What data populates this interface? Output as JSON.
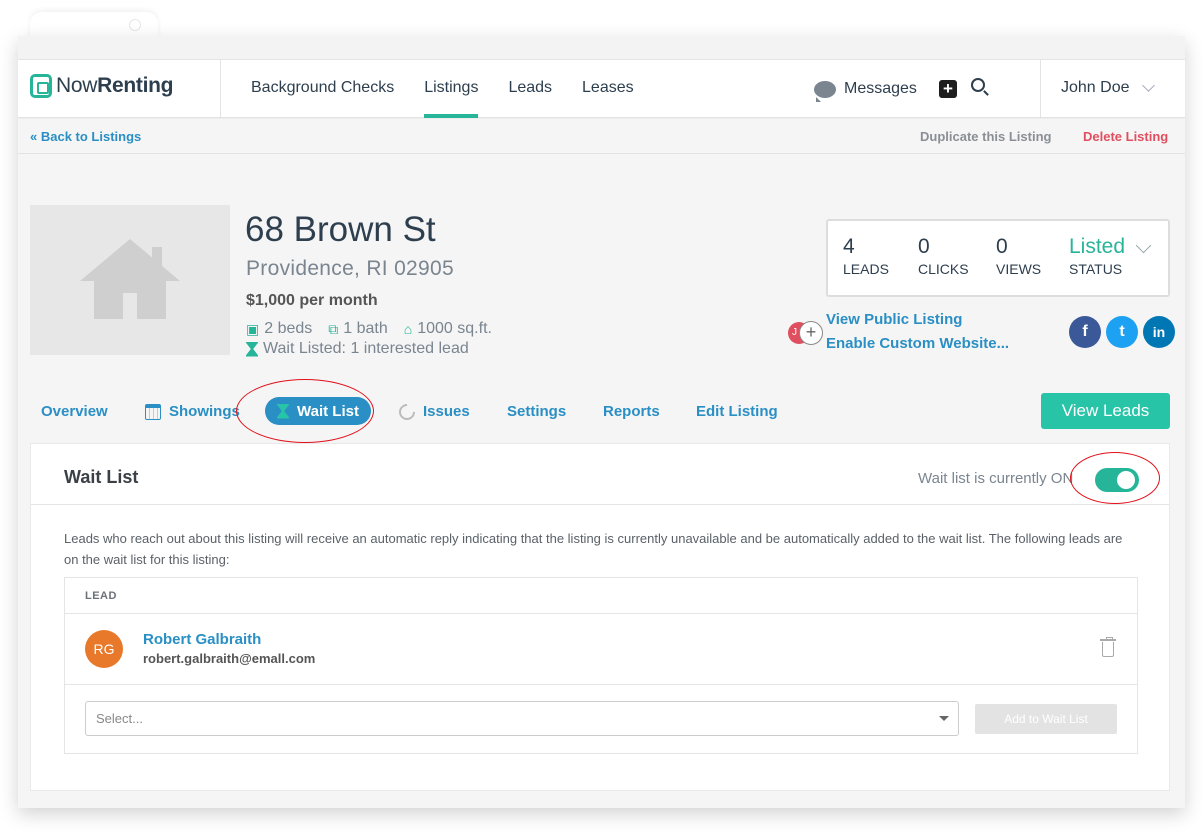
{
  "brand": {
    "name_part1": "Now",
    "name_part2": "Renting"
  },
  "nav": {
    "links": [
      "Background Checks",
      "Listings",
      "Leads",
      "Leases"
    ],
    "active": "Listings",
    "messages_label": "Messages",
    "user_name": "John Doe"
  },
  "subbar": {
    "back": "« Back to Listings",
    "duplicate": "Duplicate this Listing",
    "delete": "Delete Listing"
  },
  "listing": {
    "address": "68 Brown St",
    "city": "Providence, RI 02905",
    "rent": "$1,000 per month",
    "beds": "2 beds",
    "baths": "1 bath",
    "area": "1000 sq.ft.",
    "wait_status": "Wait Listed: 1 interested lead"
  },
  "stats": {
    "leads": {
      "value": "4",
      "label": "LEADS"
    },
    "clicks": {
      "value": "0",
      "label": "CLICKS"
    },
    "views": {
      "value": "0",
      "label": "VIEWS"
    },
    "status": {
      "value": "Listed",
      "label": "STATUS"
    }
  },
  "listing_links": {
    "public": "View Public Listing",
    "custom": "Enable Custom Website...",
    "avatar_initial": "J",
    "add_symbol": "+"
  },
  "social": {
    "facebook": "f",
    "twitter": "t",
    "linkedin": "in"
  },
  "tabs": {
    "overview": "Overview",
    "showings": "Showings",
    "waitlist": "Wait List",
    "issues": "Issues",
    "settings": "Settings",
    "reports": "Reports",
    "edit": "Edit Listing",
    "view_leads": "View Leads"
  },
  "panel": {
    "title": "Wait List",
    "status_text": "Wait list is currently ON",
    "toggle_on": true,
    "description": "Leads who reach out about this listing will receive an automatic reply indicating that the listing is currently unavailable and be automatically added to the wait list. The following leads are on the wait list for this listing:",
    "table_header": "LEAD",
    "leads": [
      {
        "initials": "RG",
        "name": "Robert Galbraith",
        "email": "robert.galbraith@emall.com"
      }
    ],
    "select_placeholder": "Select...",
    "add_button": "Add to Wait List"
  },
  "colors": {
    "accent": "#27b59a",
    "link": "#2a8fc4",
    "danger": "#e04f5f",
    "annotation": "#e0101a"
  }
}
